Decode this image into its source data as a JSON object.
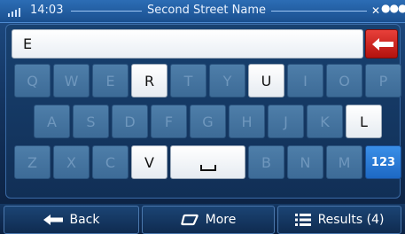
{
  "status": {
    "time": "14:03",
    "street_name": "Second Street Name"
  },
  "search": {
    "value": "E"
  },
  "keyboard": {
    "rows": [
      [
        {
          "label": "Q",
          "enabled": false
        },
        {
          "label": "W",
          "enabled": false
        },
        {
          "label": "E",
          "enabled": false
        },
        {
          "label": "R",
          "enabled": true
        },
        {
          "label": "T",
          "enabled": false
        },
        {
          "label": "Y",
          "enabled": false
        },
        {
          "label": "U",
          "enabled": true
        },
        {
          "label": "I",
          "enabled": false
        },
        {
          "label": "O",
          "enabled": false
        },
        {
          "label": "P",
          "enabled": false
        }
      ],
      [
        {
          "label": "A",
          "enabled": false
        },
        {
          "label": "S",
          "enabled": false
        },
        {
          "label": "D",
          "enabled": false
        },
        {
          "label": "F",
          "enabled": false
        },
        {
          "label": "G",
          "enabled": false
        },
        {
          "label": "H",
          "enabled": false
        },
        {
          "label": "J",
          "enabled": false
        },
        {
          "label": "K",
          "enabled": false
        },
        {
          "label": "L",
          "enabled": true
        }
      ],
      [
        {
          "label": "Z",
          "enabled": false
        },
        {
          "label": "X",
          "enabled": false
        },
        {
          "label": "C",
          "enabled": false
        },
        {
          "label": "V",
          "enabled": true
        },
        {
          "label": "",
          "type": "space",
          "enabled": true
        },
        {
          "label": "B",
          "enabled": false
        },
        {
          "label": "N",
          "enabled": false
        },
        {
          "label": "M",
          "enabled": false
        },
        {
          "label": "123",
          "type": "numeric",
          "enabled": true
        }
      ]
    ]
  },
  "bottom_bar": {
    "back_label": "Back",
    "more_label": "More",
    "results_label": "Results (4)"
  },
  "icons": {
    "backspace": "left-arrow-icon",
    "back": "back-arrow-icon",
    "more": "more-icon",
    "results": "list-icon"
  },
  "colors": {
    "backspace_key": "#d0201b",
    "numeric_key": "#2a7ad6",
    "active_key": "#ffffff",
    "disabled_key": "#4a78a3"
  }
}
